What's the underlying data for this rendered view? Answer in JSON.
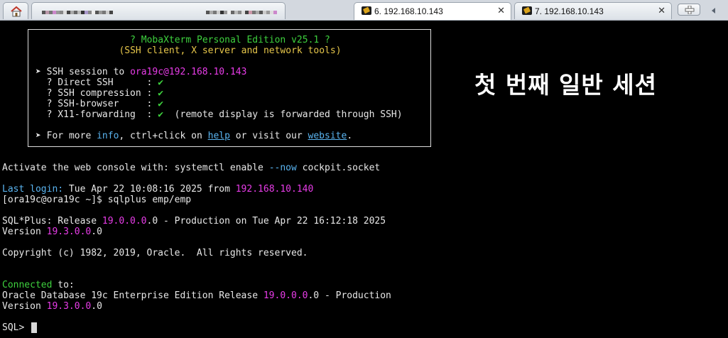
{
  "tabs": [
    {
      "type": "home",
      "icon": "home-icon"
    },
    {
      "type": "blurred",
      "label": ""
    },
    {
      "type": "ssh",
      "label": "6. 192.168.10.143",
      "active": true,
      "icon": "ssh-key-icon",
      "close": "✕"
    },
    {
      "type": "ssh",
      "label": "7. 192.168.10.143",
      "active": false,
      "icon": "ssh-key-icon",
      "close": "✕"
    }
  ],
  "banner": {
    "title": "? MobaXterm Personal Edition v25.1 ?",
    "subtitle": "(SSH client, X server and network tools)",
    "session_prefix": "➤ SSH session to ",
    "session_target": "ora19c@192.168.10.143",
    "features": [
      {
        "name": "  ? Direct SSH      :",
        "check": "✔",
        "note": ""
      },
      {
        "name": "  ? SSH compression :",
        "check": "✔",
        "note": ""
      },
      {
        "name": "  ? SSH-browser     :",
        "check": "✔",
        "note": ""
      },
      {
        "name": "  ? X11-forwarding  :",
        "check": "✔",
        "note": "  (remote display is forwarded through SSH)"
      }
    ],
    "more_prefix": "➤ For more ",
    "info": "info",
    "more_mid": ", ctrl+click on ",
    "help": "help",
    "more_mid2": " or visit our ",
    "website": "website",
    "more_end": "."
  },
  "overlay_text": "첫 번째 일반 세션",
  "terminal": {
    "activate_a": "Activate the web console with: systemctl enable ",
    "activate_b": "--now",
    "activate_c": " cockpit.socket",
    "last_login_label": "Last login:",
    "last_login_time": " Tue Apr 22 10:08:16 2025 from ",
    "last_login_ip": "192.168.10.140",
    "prompt_cmd": "[ora19c@ora19c ~]$ sqlplus emp/emp",
    "sqlplus_a": "SQL*Plus: Release ",
    "sqlplus_ver": "19.0.0.0",
    "sqlplus_b": ".0 - Production on Tue Apr 22 16:12:18 2025",
    "version_a": "Version ",
    "version_ver": "19.3.0.0",
    "version_b": ".0",
    "copyright": "Copyright (c) 1982, 2019, Oracle.  All rights reserved.",
    "connected": "Connected",
    "connected_b": " to:",
    "oracle_a": "Oracle Database 19c Enterprise Edition Release ",
    "oracle_ver": "19.0.0.0",
    "oracle_b": ".0 - Production",
    "version2_a": "Version ",
    "version2_ver": "19.3.0.0",
    "version2_b": ".0",
    "sql_prompt": "SQL> "
  }
}
